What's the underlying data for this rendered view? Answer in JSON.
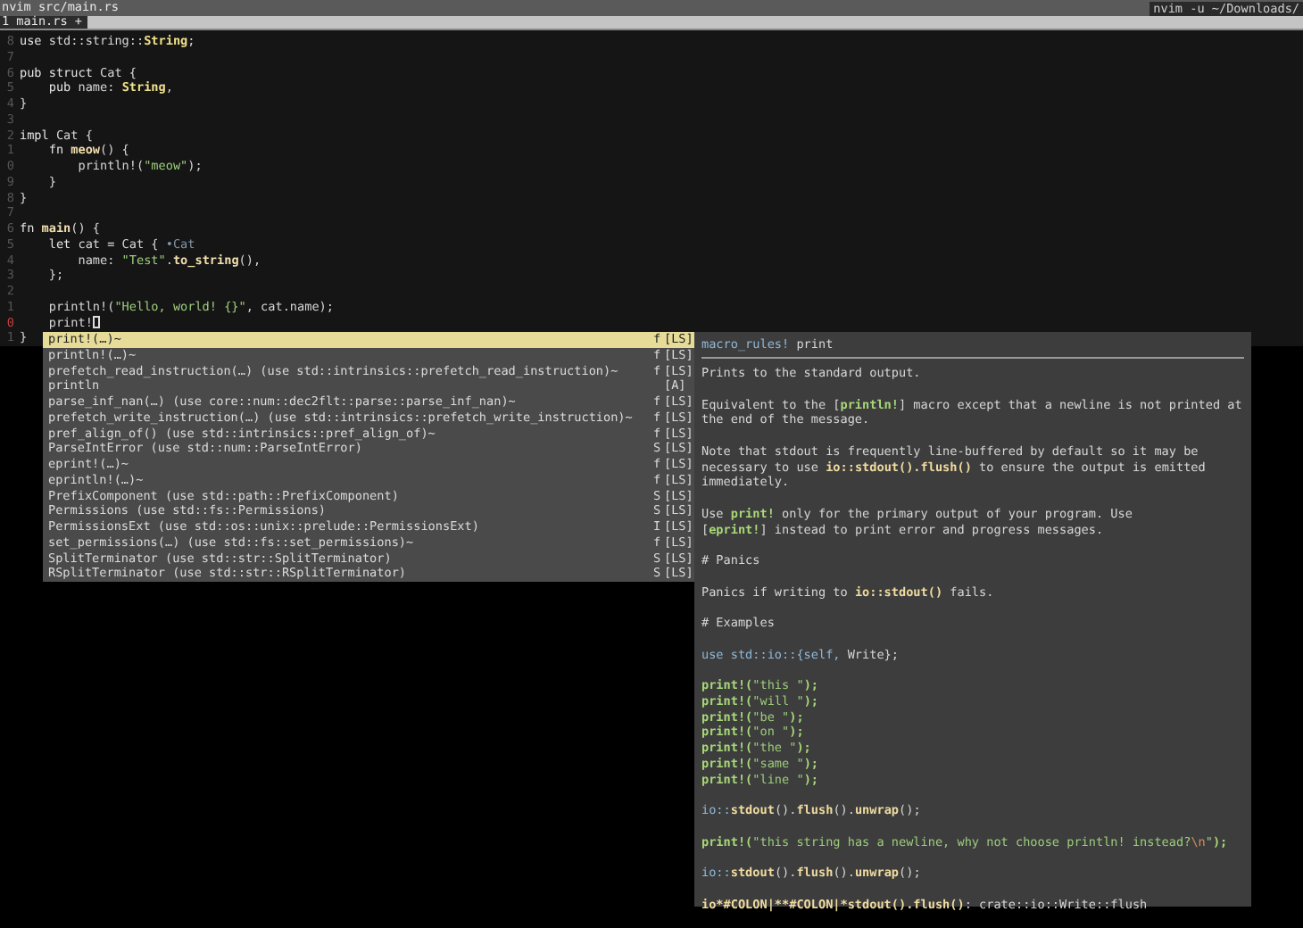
{
  "title_bar": {
    "title": "nvim src/main.rs",
    "command": "nvim -u ~/Downloads/"
  },
  "tabs": [
    {
      "label": "1 main.rs +",
      "selected": true
    }
  ],
  "editor": {
    "lines": [
      {
        "number": "8",
        "cursor": false,
        "tokens": [
          {
            "kind": "kw",
            "text": "use "
          },
          {
            "kind": "plain",
            "text": "std::string::"
          },
          {
            "kind": "type",
            "text": "String"
          },
          {
            "kind": "plain",
            "text": ";"
          }
        ]
      },
      {
        "number": "7",
        "cursor": false
      },
      {
        "number": "6",
        "cursor": false,
        "tokens": [
          {
            "kind": "kw",
            "text": "pub struct "
          },
          {
            "kind": "plain",
            "text": "Cat {"
          }
        ]
      },
      {
        "number": "5",
        "cursor": false,
        "tokens": [
          {
            "kind": "kw",
            "text": "    pub "
          },
          {
            "kind": "plain",
            "text": "name: "
          },
          {
            "kind": "type",
            "text": "String"
          },
          {
            "kind": "plain",
            "text": ","
          }
        ]
      },
      {
        "number": "4",
        "cursor": false,
        "tokens": [
          {
            "kind": "plain",
            "text": "}"
          }
        ]
      },
      {
        "number": "3",
        "cursor": false
      },
      {
        "number": "2",
        "cursor": false,
        "tokens": [
          {
            "kind": "kw",
            "text": "impl "
          },
          {
            "kind": "plain",
            "text": "Cat {"
          }
        ]
      },
      {
        "number": "1",
        "cursor": false,
        "tokens": [
          {
            "kind": "kw",
            "text": "    fn "
          },
          {
            "kind": "func",
            "text": "meow"
          },
          {
            "kind": "plain",
            "text": "() {"
          }
        ]
      },
      {
        "number": "0",
        "cursor": false,
        "tokens": [
          {
            "kind": "plain",
            "text": "        println!("
          },
          {
            "kind": "str",
            "text": "\"meow\""
          },
          {
            "kind": "plain",
            "text": ");"
          }
        ]
      },
      {
        "number": "9",
        "cursor": false,
        "tokens": [
          {
            "kind": "plain",
            "text": "    }"
          }
        ]
      },
      {
        "number": "8",
        "cursor": false,
        "tokens": [
          {
            "kind": "plain",
            "text": "}"
          }
        ]
      },
      {
        "number": "7",
        "cursor": false
      },
      {
        "number": "6",
        "cursor": false,
        "tokens": [
          {
            "kind": "kw",
            "text": "fn "
          },
          {
            "kind": "func",
            "text": "main"
          },
          {
            "kind": "plain",
            "text": "() {"
          }
        ]
      },
      {
        "number": "5",
        "cursor": false,
        "tokens": [
          {
            "kind": "kw",
            "text": "    let "
          },
          {
            "kind": "plain",
            "text": "cat = Cat { "
          },
          {
            "kind": "hint",
            "text": "•Cat"
          }
        ]
      },
      {
        "number": "4",
        "cursor": false,
        "tokens": [
          {
            "kind": "plain",
            "text": "        name: "
          },
          {
            "kind": "str",
            "text": "\"Test\""
          },
          {
            "kind": "plain",
            "text": "."
          },
          {
            "kind": "func",
            "text": "to_string"
          },
          {
            "kind": "plain",
            "text": "(),"
          }
        ]
      },
      {
        "number": "3",
        "cursor": false,
        "tokens": [
          {
            "kind": "plain",
            "text": "    };"
          }
        ]
      },
      {
        "number": "2",
        "cursor": false
      },
      {
        "number": "1",
        "cursor": false,
        "tokens": [
          {
            "kind": "plain",
            "text": "    println!("
          },
          {
            "kind": "str",
            "text": "\"Hello, world! {}\""
          },
          {
            "kind": "plain",
            "text": ", cat.name);"
          }
        ]
      },
      {
        "number": "0",
        "cursor": true,
        "tokens": [
          {
            "kind": "plain",
            "text": "    print!"
          }
        ]
      },
      {
        "number": "1",
        "cursor": false,
        "tokens": [
          {
            "kind": "plain",
            "text": "}"
          }
        ]
      }
    ]
  },
  "completion_menu": {
    "items": [
      {
        "label": "print!(…)~",
        "kind": "f",
        "source": "[LS]",
        "selected": true
      },
      {
        "label": "println!(…)~",
        "kind": "f",
        "source": "[LS]",
        "selected": false
      },
      {
        "label": "prefetch_read_instruction(…) (use std::intrinsics::prefetch_read_instruction)~",
        "kind": "f",
        "source": "[LS]",
        "selected": false
      },
      {
        "label": "println",
        "source": "[A]",
        "selected": false
      },
      {
        "label": "parse_inf_nan(…) (use core::num::dec2flt::parse::parse_inf_nan)~",
        "kind": "f",
        "source": "[LS]",
        "selected": false
      },
      {
        "label": "prefetch_write_instruction(…) (use std::intrinsics::prefetch_write_instruction)~",
        "kind": "f",
        "source": "[LS]",
        "selected": false
      },
      {
        "label": "pref_align_of() (use std::intrinsics::pref_align_of)~",
        "kind": "f",
        "source": "[LS]",
        "selected": false
      },
      {
        "label": "ParseIntError (use std::num::ParseIntError)",
        "kind": "S",
        "source": "[LS]",
        "selected": false
      },
      {
        "label": "eprint!(…)~",
        "kind": "f",
        "source": "[LS]",
        "selected": false
      },
      {
        "label": "eprintln!(…)~",
        "kind": "f",
        "source": "[LS]",
        "selected": false
      },
      {
        "label": "PrefixComponent (use std::path::PrefixComponent)",
        "kind": "S",
        "source": "[LS]",
        "selected": false
      },
      {
        "label": "Permissions (use std::fs::Permissions)",
        "kind": "S",
        "source": "[LS]",
        "selected": false
      },
      {
        "label": "PermissionsExt (use std::os::unix::prelude::PermissionsExt)",
        "kind": "I",
        "source": "[LS]",
        "selected": false
      },
      {
        "label": "set_permissions(…) (use std::fs::set_permissions)~",
        "kind": "f",
        "source": "[LS]",
        "selected": false
      },
      {
        "label": "SplitTerminator (use std::str::SplitTerminator)",
        "kind": "S",
        "source": "[LS]",
        "selected": false
      },
      {
        "label": "RSplitTerminator (use std::str::RSplitTerminator)",
        "kind": "S",
        "source": "[LS]",
        "selected": false
      }
    ]
  },
  "doc_panel": {
    "header": [
      {
        "kind": "macro",
        "text": "macro_rules! "
      },
      {
        "kind": "plain",
        "text": "print"
      }
    ],
    "blocks": [
      [
        [
          {
            "kind": "plain",
            "text": "Prints to the standard output."
          }
        ]
      ],
      [
        [
          {
            "kind": "plain",
            "text": "Equivalent to the ["
          },
          {
            "kind": "link",
            "text": "println!"
          },
          {
            "kind": "plain",
            "text": "] macro except that a newline is not printed at"
          }
        ],
        [
          {
            "kind": "plain",
            "text": "the end of the message."
          }
        ]
      ],
      [
        [
          {
            "kind": "plain",
            "text": "Note that stdout is frequently line-buffered by default so it may be"
          }
        ],
        [
          {
            "kind": "plain",
            "text": "necessary to use "
          },
          {
            "kind": "code",
            "text": "io::stdout().flush()"
          },
          {
            "kind": "plain",
            "text": " to ensure the output is emitted"
          }
        ],
        [
          {
            "kind": "plain",
            "text": "immediately."
          }
        ]
      ],
      [
        [
          {
            "kind": "plain",
            "text": "Use "
          },
          {
            "kind": "link",
            "text": "print!"
          },
          {
            "kind": "plain",
            "text": " only for the primary output of your program. Use"
          }
        ],
        [
          {
            "kind": "plain",
            "text": "["
          },
          {
            "kind": "link",
            "text": "eprint!"
          },
          {
            "kind": "plain",
            "text": "] instead to print error and progress messages."
          }
        ]
      ],
      [
        [
          {
            "kind": "plain",
            "text": "# Panics"
          }
        ]
      ],
      [
        [
          {
            "kind": "plain",
            "text": "Panics if writing to "
          },
          {
            "kind": "code",
            "text": "io::stdout()"
          },
          {
            "kind": "plain",
            "text": " fails."
          }
        ]
      ],
      [
        [
          {
            "kind": "plain",
            "text": "# Examples"
          }
        ]
      ],
      [
        [
          {
            "kind": "macro",
            "text": "use std::io::{self, "
          },
          {
            "kind": "plain",
            "text": "Write};"
          }
        ]
      ],
      [
        [
          {
            "kind": "link",
            "text": "print!("
          },
          {
            "kind": "str",
            "text": "\"this \""
          },
          {
            "kind": "link",
            "text": ");"
          }
        ],
        [
          {
            "kind": "link",
            "text": "print!("
          },
          {
            "kind": "str",
            "text": "\"will \""
          },
          {
            "kind": "link",
            "text": ");"
          }
        ],
        [
          {
            "kind": "link",
            "text": "print!("
          },
          {
            "kind": "str",
            "text": "\"be \""
          },
          {
            "kind": "link",
            "text": ");"
          }
        ],
        [
          {
            "kind": "link",
            "text": "print!("
          },
          {
            "kind": "str",
            "text": "\"on \""
          },
          {
            "kind": "link",
            "text": ");"
          }
        ],
        [
          {
            "kind": "link",
            "text": "print!("
          },
          {
            "kind": "str",
            "text": "\"the \""
          },
          {
            "kind": "link",
            "text": ");"
          }
        ],
        [
          {
            "kind": "link",
            "text": "print!("
          },
          {
            "kind": "str",
            "text": "\"same \""
          },
          {
            "kind": "link",
            "text": ");"
          }
        ],
        [
          {
            "kind": "link",
            "text": "print!("
          },
          {
            "kind": "str",
            "text": "\"line \""
          },
          {
            "kind": "link",
            "text": ");"
          }
        ]
      ],
      [
        [
          {
            "kind": "macro",
            "text": "io::"
          },
          {
            "kind": "code",
            "text": "stdout"
          },
          {
            "kind": "plain",
            "text": "()."
          },
          {
            "kind": "code",
            "text": "flush"
          },
          {
            "kind": "plain",
            "text": "()."
          },
          {
            "kind": "code",
            "text": "unwrap"
          },
          {
            "kind": "plain",
            "text": "();"
          }
        ]
      ],
      [
        [
          {
            "kind": "link",
            "text": "print!("
          },
          {
            "kind": "str",
            "text": "\"this string has a newline, why not choose println! instead?"
          },
          {
            "kind": "escape",
            "text": "\\n"
          },
          {
            "kind": "str",
            "text": "\""
          },
          {
            "kind": "link",
            "text": ");"
          }
        ]
      ],
      [
        [
          {
            "kind": "macro",
            "text": "io::"
          },
          {
            "kind": "code",
            "text": "stdout"
          },
          {
            "kind": "plain",
            "text": "()."
          },
          {
            "kind": "code",
            "text": "flush"
          },
          {
            "kind": "plain",
            "text": "()."
          },
          {
            "kind": "code",
            "text": "unwrap"
          },
          {
            "kind": "plain",
            "text": "();"
          }
        ]
      ],
      [
        [
          {
            "kind": "code",
            "text": "io*#COLON|**#COLON|*stdout().flush()"
          },
          {
            "kind": "plain",
            "text": ": crate::io::Write::flush"
          }
        ]
      ]
    ]
  }
}
